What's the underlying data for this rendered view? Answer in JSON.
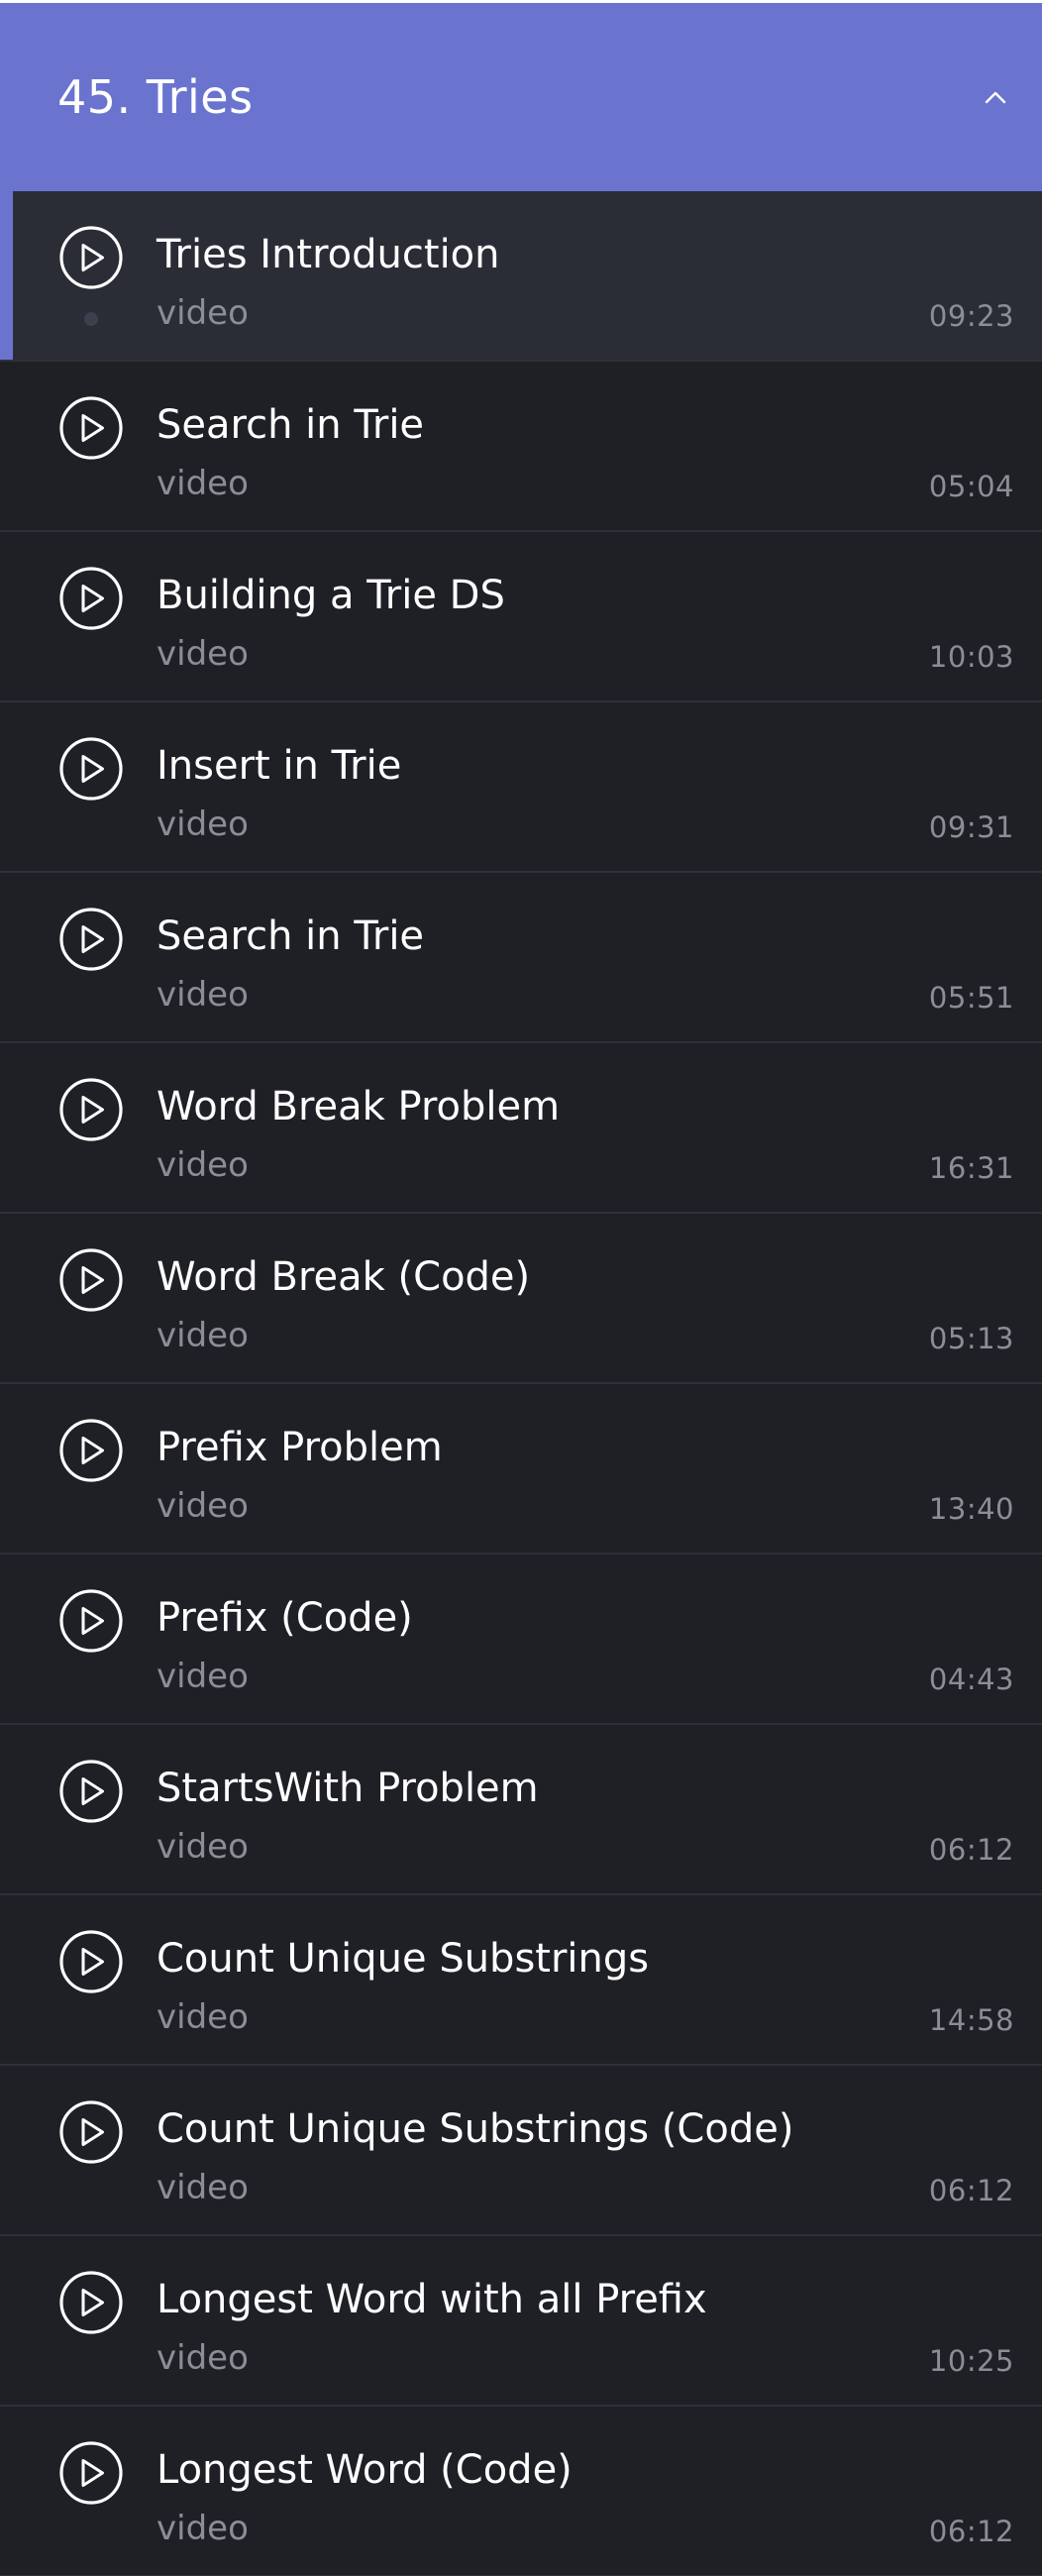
{
  "section": {
    "title": "45. Tries",
    "icon": "chevron-up-icon",
    "expanded": true,
    "accent_color": "#6a74cf"
  },
  "lectures": [
    {
      "title": "Tries Introduction",
      "type": "video",
      "duration": "09:23",
      "active": true,
      "icon": "play-circle-icon"
    },
    {
      "title": "Search in Trie",
      "type": "video",
      "duration": "05:04",
      "active": false,
      "icon": "play-circle-icon"
    },
    {
      "title": "Building a Trie DS",
      "type": "video",
      "duration": "10:03",
      "active": false,
      "icon": "play-circle-icon"
    },
    {
      "title": "Insert in Trie",
      "type": "video",
      "duration": "09:31",
      "active": false,
      "icon": "play-circle-icon"
    },
    {
      "title": "Search in Trie",
      "type": "video",
      "duration": "05:51",
      "active": false,
      "icon": "play-circle-icon"
    },
    {
      "title": "Word Break Problem",
      "type": "video",
      "duration": "16:31",
      "active": false,
      "icon": "play-circle-icon"
    },
    {
      "title": "Word Break (Code)",
      "type": "video",
      "duration": "05:13",
      "active": false,
      "icon": "play-circle-icon"
    },
    {
      "title": "Prefix Problem",
      "type": "video",
      "duration": "13:40",
      "active": false,
      "icon": "play-circle-icon"
    },
    {
      "title": "Prefix (Code)",
      "type": "video",
      "duration": "04:43",
      "active": false,
      "icon": "play-circle-icon"
    },
    {
      "title": "StartsWith Problem",
      "type": "video",
      "duration": "06:12",
      "active": false,
      "icon": "play-circle-icon"
    },
    {
      "title": "Count Unique Substrings",
      "type": "video",
      "duration": "14:58",
      "active": false,
      "icon": "play-circle-icon"
    },
    {
      "title": "Count Unique Substrings (Code)",
      "type": "video",
      "duration": "06:12",
      "active": false,
      "icon": "play-circle-icon"
    },
    {
      "title": "Longest Word with all Prefix",
      "type": "video",
      "duration": "10:25",
      "active": false,
      "icon": "play-circle-icon"
    },
    {
      "title": "Longest Word (Code)",
      "type": "video",
      "duration": "06:12",
      "active": false,
      "icon": "play-circle-icon"
    }
  ]
}
